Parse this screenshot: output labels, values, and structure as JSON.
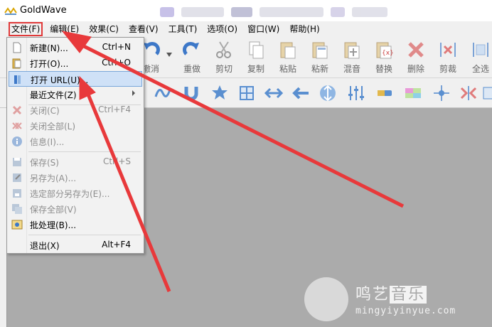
{
  "window": {
    "title": "GoldWave"
  },
  "menubar": {
    "items": [
      {
        "label": "文件(F)"
      },
      {
        "label": "编辑(E)"
      },
      {
        "label": "效果(C)"
      },
      {
        "label": "查看(V)"
      },
      {
        "label": "工具(T)"
      },
      {
        "label": "选项(O)"
      },
      {
        "label": "窗口(W)"
      },
      {
        "label": "帮助(H)"
      }
    ]
  },
  "toolbar": {
    "buttons": [
      {
        "label": "撤消",
        "icon": "undo-icon"
      },
      {
        "label": "重做",
        "icon": "redo-icon"
      },
      {
        "label": "剪切",
        "icon": "cut-icon"
      },
      {
        "label": "复制",
        "icon": "copy-icon"
      },
      {
        "label": "粘贴",
        "icon": "paste-icon"
      },
      {
        "label": "粘新",
        "icon": "paste-new-icon"
      },
      {
        "label": "混音",
        "icon": "mix-icon"
      },
      {
        "label": "替换",
        "icon": "replace-icon"
      },
      {
        "label": "删除",
        "icon": "delete-icon"
      },
      {
        "label": "剪裁",
        "icon": "trim-icon"
      },
      {
        "label": "全选",
        "icon": "select-all-icon"
      }
    ]
  },
  "file_menu": {
    "items": [
      {
        "label": "新建(N)...",
        "shortcut": "Ctrl+N",
        "icon": "new-file-icon",
        "enabled": true
      },
      {
        "label": "打开(O)...",
        "shortcut": "Ctrl+O",
        "icon": "open-file-icon",
        "enabled": true
      },
      {
        "label": "打开 URL(U)...",
        "shortcut": "",
        "icon": "open-url-icon",
        "enabled": true,
        "highlighted": true
      },
      {
        "label": "最近文件(Z)",
        "shortcut": "",
        "icon": "",
        "enabled": true,
        "submenu": true
      },
      {
        "label": "关闭(C)",
        "shortcut": "Ctrl+F4",
        "icon": "close-icon",
        "enabled": false
      },
      {
        "label": "关闭全部(L)",
        "shortcut": "",
        "icon": "close-all-icon",
        "enabled": false
      },
      {
        "label": "信息(I)...",
        "shortcut": "",
        "icon": "info-icon",
        "enabled": false
      },
      {
        "label": "保存(S)",
        "shortcut": "Ctrl+S",
        "icon": "save-icon",
        "enabled": false
      },
      {
        "label": "另存为(A)...",
        "shortcut": "",
        "icon": "save-as-icon",
        "enabled": false
      },
      {
        "label": "选定部分另存为(E)...",
        "shortcut": "",
        "icon": "save-selection-icon",
        "enabled": false
      },
      {
        "label": "保存全部(V)",
        "shortcut": "",
        "icon": "save-all-icon",
        "enabled": false
      },
      {
        "label": "批处理(B)...",
        "shortcut": "",
        "icon": "batch-icon",
        "enabled": true
      },
      {
        "label": "退出(X)",
        "shortcut": "Alt+F4",
        "icon": "",
        "enabled": true
      }
    ]
  },
  "watermark": {
    "title": "鸣艺音乐",
    "title_plain": "鸣艺",
    "title_boxed": "音乐",
    "url": "mingyiyinyue.com"
  },
  "colors": {
    "annotation": "#e8393b",
    "menu_highlight": "#cfe1f7",
    "workspace": "#ababab"
  }
}
